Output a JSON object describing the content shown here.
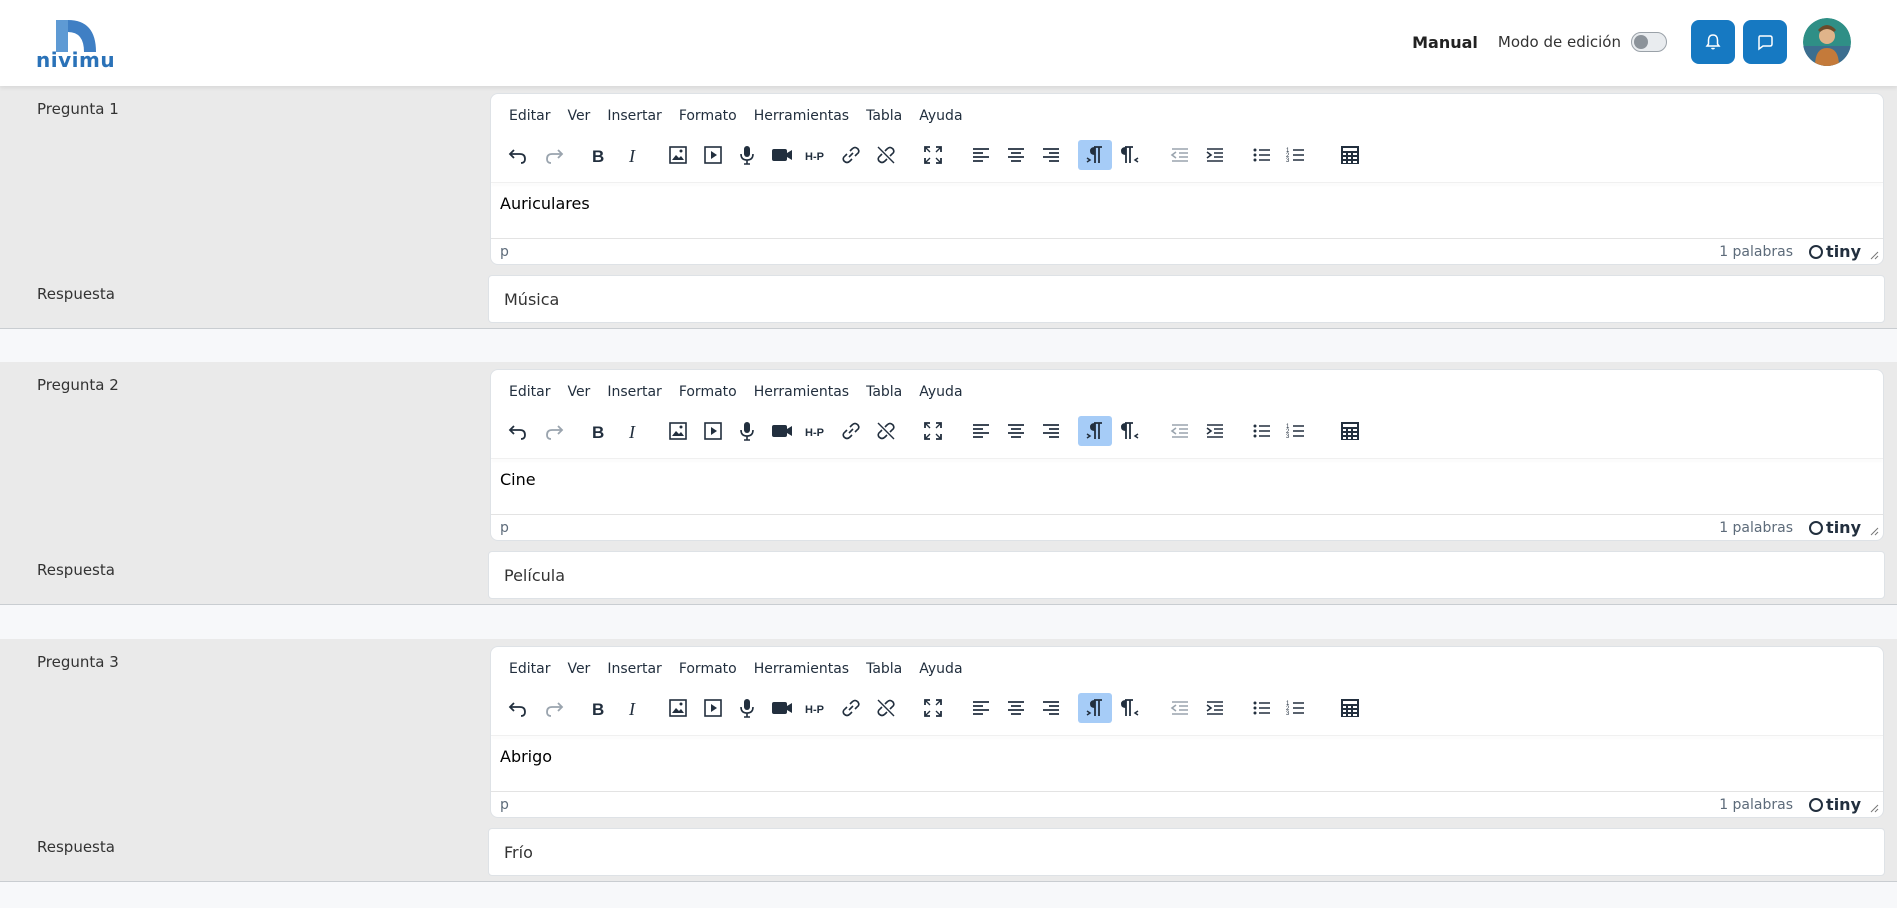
{
  "header": {
    "logo_text": "nivimu",
    "manual_label": "Manual",
    "edit_mode_label": "Modo de edición",
    "brand_color": "#1679c2"
  },
  "editor": {
    "menu": [
      "Editar",
      "Ver",
      "Insertar",
      "Formato",
      "Herramientas",
      "Tabla",
      "Ayuda"
    ],
    "toolbar": [
      "undo-icon",
      "redo-icon",
      "bold-icon",
      "italic-icon",
      "image-icon",
      "media-icon",
      "microphone-icon",
      "video-camera-icon",
      "h5p-icon",
      "link-icon",
      "unlink-icon",
      "fullscreen-icon",
      "align-left-icon",
      "align-center-icon",
      "align-right-icon",
      "ltr-icon",
      "rtl-icon",
      "outdent-icon",
      "indent-icon",
      "bullet-list-icon",
      "numbered-list-icon",
      "calculator-icon"
    ],
    "h5p_text": "H‐P",
    "tiny_label": "tiny"
  },
  "questions": [
    {
      "label": "Pregunta 1",
      "content": "Auriculares",
      "path": "p",
      "word_count": "1 palabras",
      "answer_label": "Respuesta",
      "answer_value": "Música"
    },
    {
      "label": "Pregunta 2",
      "content": "Cine",
      "path": "p",
      "word_count": "1 palabras",
      "answer_label": "Respuesta",
      "answer_value": "Película"
    },
    {
      "label": "Pregunta 3",
      "content": "Abrigo",
      "path": "p",
      "word_count": "1 palabras",
      "answer_label": "Respuesta",
      "answer_value": "Frío"
    }
  ]
}
